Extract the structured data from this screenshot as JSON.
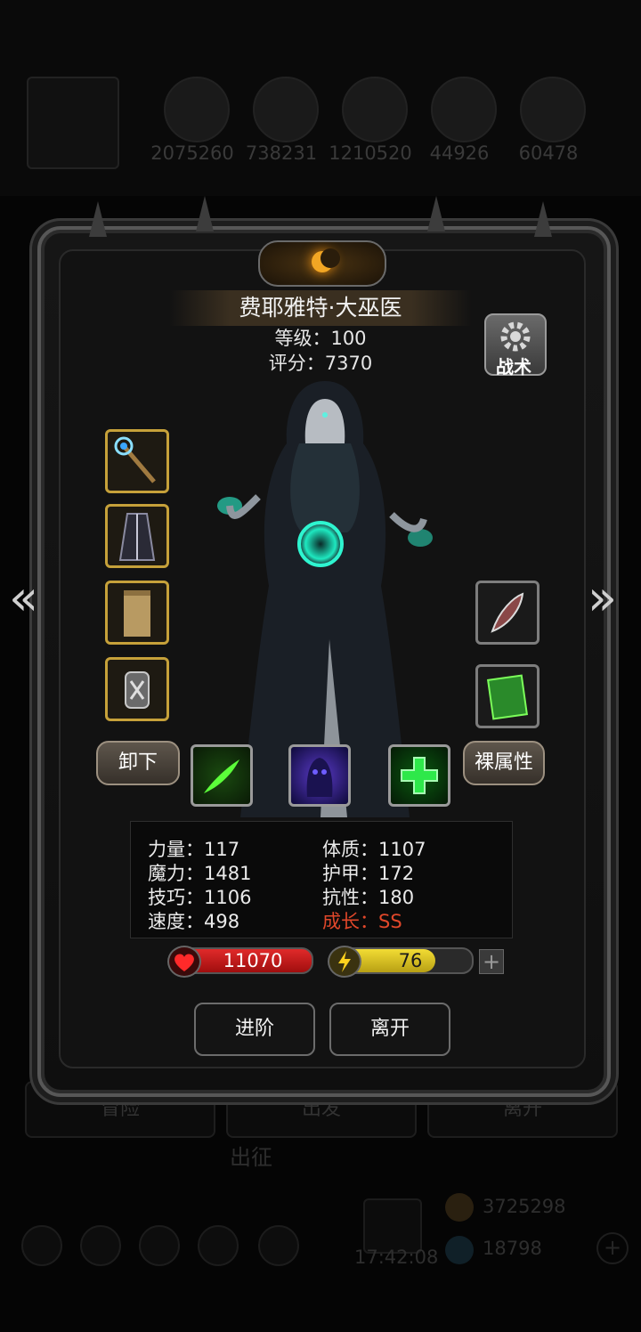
{
  "background": {
    "resources": [
      "2075260",
      "738231",
      "1210520",
      "44926",
      "60478"
    ],
    "tabs": [
      "冒险",
      "出发",
      "离开"
    ],
    "section_label": "出征",
    "gold": "3725298",
    "gems": "18798",
    "time": "17:42:08"
  },
  "hero": {
    "name": "费耶雅特·大巫医",
    "level_label": "等级：100",
    "score_label": "评分：7370"
  },
  "buttons": {
    "tactics": "战术",
    "unequip": "卸下",
    "base_attributes": "裸属性",
    "advance": "进阶",
    "leave": "离开"
  },
  "stats": {
    "strength": "力量：117",
    "magic": "魔力：1481",
    "skill": "技巧：1106",
    "speed": "速度：498",
    "constitution": "体质：1107",
    "armor": "护甲：172",
    "resistance": "抗性：180",
    "growth": "成长：SS"
  },
  "bars": {
    "hp": "11070",
    "energy": "76",
    "energy_fraction": 0.76
  },
  "icons": {
    "left_slots": [
      "staff-icon",
      "robe-icon",
      "scroll-icon",
      "armguard-icon"
    ],
    "right_slots": [
      "feather-icon",
      "card-icon"
    ],
    "skills": [
      "green-bolt-icon",
      "shadow-spirit-icon",
      "heal-cross-icon"
    ]
  },
  "colors": {
    "gold_border": "#c6a13a",
    "hp_red": "#d01818",
    "energy_yellow": "#d8c020",
    "growth_red": "#e0472a"
  }
}
